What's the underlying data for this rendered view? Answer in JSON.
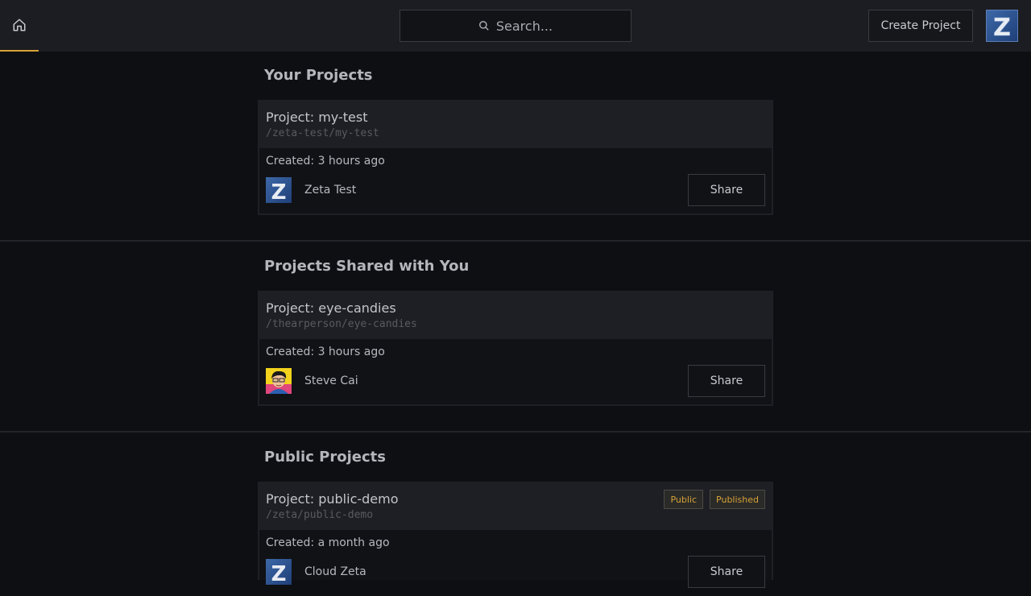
{
  "topbar": {
    "home_icon": "home-icon",
    "search_placeholder": "Search...",
    "search_icon": "search-icon",
    "create_label": "Create Project",
    "avatar_letter": "Z"
  },
  "sections": {
    "yours": {
      "title": "Your Projects",
      "card": {
        "title": "Project: my-test",
        "path": "/zeta-test/my-test",
        "created": "Created: 3 hours ago",
        "owner": "Zeta Test",
        "avatar_letter": "Z",
        "share": "Share"
      }
    },
    "shared": {
      "title": "Projects Shared with You",
      "card": {
        "title": "Project: eye-candies",
        "path": "/thearperson/eye-candies",
        "created": "Created: 3 hours ago",
        "owner": "Steve Cai",
        "share": "Share"
      }
    },
    "public": {
      "title": "Public Projects",
      "card": {
        "title": "Project: public-demo",
        "path": "/zeta/public-demo",
        "created": "Created: a month ago",
        "owner": "Cloud Zeta",
        "avatar_letter": "Z",
        "share": "Share",
        "badges": [
          "Public",
          "Published"
        ]
      }
    }
  },
  "colors": {
    "accent": "#d7a335",
    "background": "#0e0f13",
    "topbar": "#1c1d22"
  }
}
